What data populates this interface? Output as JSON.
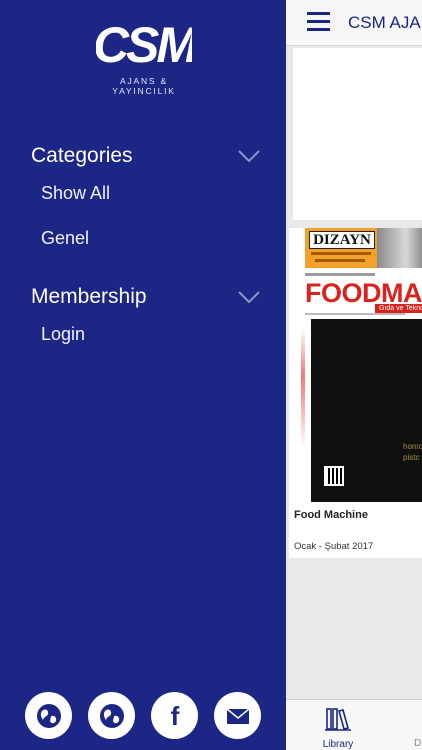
{
  "drawer": {
    "logo": {
      "mark": "CSM",
      "subtitle": "AJANS & YAYINCILIK"
    },
    "sections": [
      {
        "title": "Categories",
        "items": [
          "Show All",
          "Genel"
        ]
      },
      {
        "title": "Membership",
        "items": [
          "Login"
        ]
      }
    ],
    "social": [
      "globe-icon",
      "globe-icon",
      "facebook-icon",
      "mail-icon"
    ],
    "brand_color": "#1c2684"
  },
  "main": {
    "app_title": "CSM AJA",
    "magazine": {
      "ad_brand": "DIZAYN",
      "cover_title": "FOODMAC",
      "cover_band": "Gıda ve Tekno",
      "cover_text": "homog\npistc",
      "name": "Food Machine",
      "date": "Ocak - Şubat 2017"
    },
    "tabs": [
      {
        "label": "Library",
        "icon": "library-icon"
      },
      {
        "label": "D"
      }
    ]
  }
}
